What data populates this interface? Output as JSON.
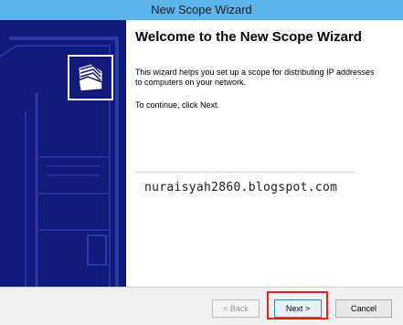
{
  "window": {
    "title": "New Scope Wizard"
  },
  "banner": {
    "icon": "folder-stack-icon",
    "background_color": "#111a7a"
  },
  "content": {
    "heading": "Welcome to the New Scope Wizard",
    "description": "This wizard helps you set up a scope for distributing IP addresses to computers on your network.",
    "instruction": "To continue, click Next."
  },
  "watermark": {
    "text": "nuraisyah2860.blogspot.com"
  },
  "buttons": {
    "back_label": "< Back",
    "next_label": "Next >",
    "cancel_label": "Cancel"
  },
  "colors": {
    "titlebar": "#5bb5ea",
    "highlight": "#e2231a"
  }
}
